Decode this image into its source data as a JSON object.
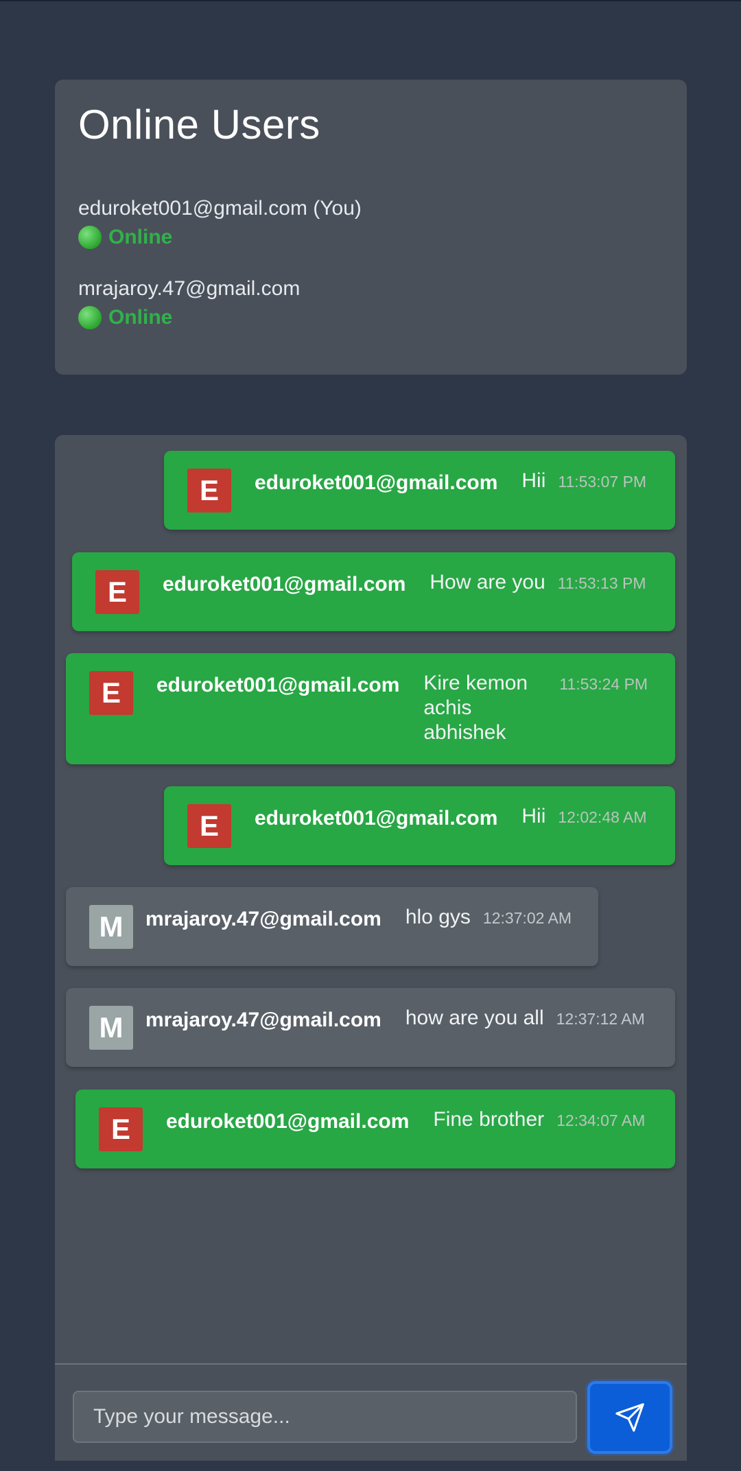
{
  "online_users": {
    "title": "Online Users",
    "users": [
      {
        "email": "eduroket001@gmail.com (You)",
        "status": "Online"
      },
      {
        "email": "mrajaroy.47@gmail.com",
        "status": "Online"
      }
    ]
  },
  "messages": [
    {
      "avatar": "E",
      "sender": "eduroket001@gmail.com",
      "text": "Hii",
      "time": "11:53:07 PM",
      "mine": true
    },
    {
      "avatar": "E",
      "sender": "eduroket001@gmail.com",
      "text": "How are you",
      "time": "11:53:13 PM",
      "mine": true
    },
    {
      "avatar": "E",
      "sender": "eduroket001@gmail.com",
      "text": "Kire kemon achis abhishek",
      "time": "11:53:24 PM",
      "mine": true
    },
    {
      "avatar": "E",
      "sender": "eduroket001@gmail.com",
      "text": "Hii",
      "time": "12:02:48 AM",
      "mine": true
    },
    {
      "avatar": "M",
      "sender": "mrajaroy.47@gmail.com",
      "text": "hlo gys",
      "time": "12:37:02 AM",
      "mine": false
    },
    {
      "avatar": "M",
      "sender": "mrajaroy.47@gmail.com",
      "text": "how are you all",
      "time": "12:37:12 AM",
      "mine": false
    },
    {
      "avatar": "E",
      "sender": "eduroket001@gmail.com",
      "text": "Fine brother",
      "time": "12:34:07 AM",
      "mine": true
    }
  ],
  "composer": {
    "placeholder": "Type your message...",
    "send_icon": "paper-plane-icon"
  },
  "colors": {
    "background": "#2d3748",
    "card": "#4a5059",
    "own_bubble": "#28a745",
    "other_bubble": "#5a6068",
    "avatar_own": "#c23a30",
    "avatar_other": "#9aa5a5",
    "online": "#2fb24a",
    "send_button": "#0b5ed7"
  }
}
